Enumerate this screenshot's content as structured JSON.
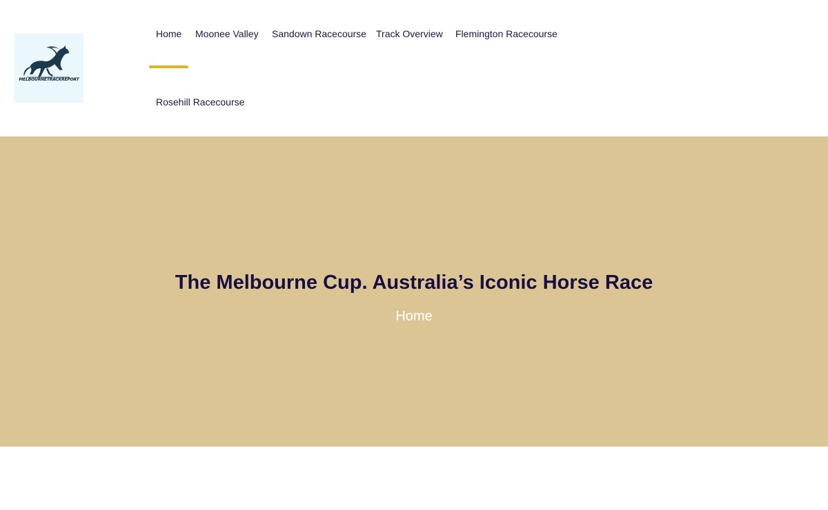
{
  "header": {
    "logo_text": "MELBOURNETRACKREPORT",
    "nav": [
      {
        "label": "Home",
        "active": true
      },
      {
        "label": "Moonee Valley"
      },
      {
        "label": "Sandown Racecourse"
      },
      {
        "label": "Track Overview"
      },
      {
        "label": "Flemington Racecourse"
      },
      {
        "label": "Rosehill Racecourse"
      }
    ],
    "accent_color": "#e0b31f"
  },
  "hero": {
    "title": "The Melbourne Cup. Australia’s Iconic Horse Race",
    "breadcrumb": "Home",
    "background_color": "#dbc594"
  }
}
